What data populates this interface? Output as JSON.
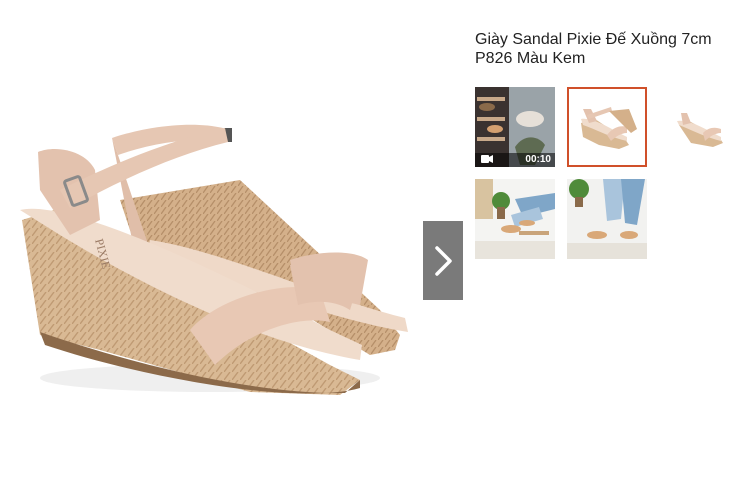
{
  "product": {
    "title": "Giày Sandal Pixie Đế Xuồng 7cm P826 Màu Kem"
  },
  "main_image": {
    "alt": "Giày Sandal Pixie Đế Xuồng 7cm P826 Màu Kem",
    "brand_mark": "PIXIE"
  },
  "gallery": {
    "thumbnails": [
      {
        "kind": "video",
        "duration": "00:10"
      },
      {
        "kind": "image",
        "selected": true
      },
      {
        "kind": "image"
      },
      {
        "kind": "image"
      },
      {
        "kind": "image"
      }
    ]
  },
  "colors": {
    "accent": "#d0502a",
    "nav_button": "#7a7a7a",
    "strap": "#e3c2ae",
    "wedge": "#d6b48e"
  },
  "icons": {
    "next": "chevron-right-icon",
    "video": "video-camera-icon"
  }
}
